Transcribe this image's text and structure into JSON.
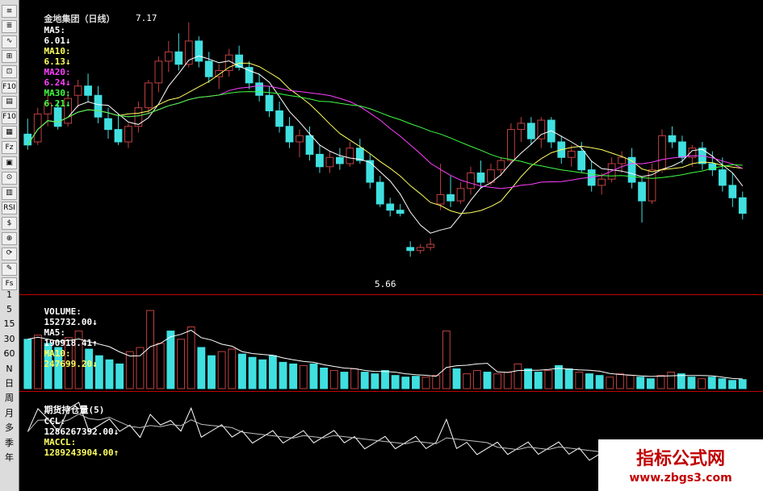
{
  "toolbar": {
    "buttons": [
      "≡",
      "≣",
      "∿",
      "⊞",
      "⊡",
      "F10",
      "▤",
      "F10",
      "▦",
      "Fz",
      "▣",
      "⊙",
      "▥",
      "RSI",
      "$",
      "⊕",
      "⟳",
      "✎",
      "Fs"
    ],
    "ylabels": [
      "1",
      "5",
      "15",
      "30",
      "60",
      "N",
      "日",
      "周",
      "月",
      "多",
      "季",
      "年"
    ]
  },
  "price_header": {
    "name": "金地集团（日线）",
    "ma5_label": "MA5:",
    "ma5_value": "6.01↓",
    "ma10_label": "MA10:",
    "ma10_value": "6.13↓",
    "ma20_label": "MA20:",
    "ma20_value": "6.24↓",
    "ma30_label": "MA30:",
    "ma30_value": "6.21↓"
  },
  "price_annotations": {
    "high": "7.17",
    "low": "5.66"
  },
  "volume_header": {
    "label": "VOLUME:",
    "value": "152732.00↓",
    "ma5_label": "MA5:",
    "ma5_value": "190918.41↑",
    "ma10_label": "MA10:",
    "ma10_value": "247699.20↓"
  },
  "oi_header": {
    "label": "期货持仓量(5)",
    "ccl_label": "CCL:",
    "ccl_value": "1286267392.00↓",
    "maccl_label": "MACCL:",
    "maccl_value": "1289243904.00↑"
  },
  "watermark": {
    "title": "指标公式网",
    "url": "www.zbgs3.com"
  },
  "colors": {
    "up": "#c04040",
    "down": "#40e0e0",
    "ma5": "#ffffff",
    "ma10": "#ffff60",
    "ma20": "#ff40ff",
    "ma30": "#40ff40",
    "grid": "#c00000",
    "oi": "#ffffff",
    "oi_ma": "#c0c0c0"
  },
  "chart_data": {
    "type": "candlestick",
    "price_range": [
      5.66,
      7.17
    ],
    "price_candles": [
      {
        "o": 6.45,
        "h": 6.55,
        "l": 6.35,
        "c": 6.38
      },
      {
        "o": 6.4,
        "h": 6.62,
        "l": 6.38,
        "c": 6.58
      },
      {
        "o": 6.58,
        "h": 6.7,
        "l": 6.5,
        "c": 6.65
      },
      {
        "o": 6.62,
        "h": 6.66,
        "l": 6.48,
        "c": 6.5
      },
      {
        "o": 6.52,
        "h": 6.72,
        "l": 6.5,
        "c": 6.68
      },
      {
        "o": 6.7,
        "h": 6.8,
        "l": 6.62,
        "c": 6.76
      },
      {
        "o": 6.76,
        "h": 6.84,
        "l": 6.66,
        "c": 6.7
      },
      {
        "o": 6.7,
        "h": 6.76,
        "l": 6.52,
        "c": 6.56
      },
      {
        "o": 6.55,
        "h": 6.62,
        "l": 6.42,
        "c": 6.48
      },
      {
        "o": 6.48,
        "h": 6.58,
        "l": 6.38,
        "c": 6.4
      },
      {
        "o": 6.4,
        "h": 6.52,
        "l": 6.36,
        "c": 6.5
      },
      {
        "o": 6.5,
        "h": 6.66,
        "l": 6.46,
        "c": 6.62
      },
      {
        "o": 6.62,
        "h": 6.8,
        "l": 6.58,
        "c": 6.78
      },
      {
        "o": 6.78,
        "h": 6.95,
        "l": 6.72,
        "c": 6.92
      },
      {
        "o": 6.92,
        "h": 7.05,
        "l": 6.85,
        "c": 6.98
      },
      {
        "o": 6.98,
        "h": 7.1,
        "l": 6.86,
        "c": 6.9
      },
      {
        "o": 6.9,
        "h": 7.17,
        "l": 6.88,
        "c": 7.05
      },
      {
        "o": 7.05,
        "h": 7.08,
        "l": 6.88,
        "c": 6.92
      },
      {
        "o": 6.92,
        "h": 6.98,
        "l": 6.78,
        "c": 6.82
      },
      {
        "o": 6.82,
        "h": 6.9,
        "l": 6.74,
        "c": 6.86
      },
      {
        "o": 6.86,
        "h": 7.0,
        "l": 6.82,
        "c": 6.96
      },
      {
        "o": 6.96,
        "h": 7.02,
        "l": 6.86,
        "c": 6.88
      },
      {
        "o": 6.88,
        "h": 6.92,
        "l": 6.74,
        "c": 6.78
      },
      {
        "o": 6.78,
        "h": 6.84,
        "l": 6.66,
        "c": 6.7
      },
      {
        "o": 6.7,
        "h": 6.76,
        "l": 6.56,
        "c": 6.6
      },
      {
        "o": 6.6,
        "h": 6.66,
        "l": 6.46,
        "c": 6.5
      },
      {
        "o": 6.5,
        "h": 6.56,
        "l": 6.36,
        "c": 6.4
      },
      {
        "o": 6.4,
        "h": 6.48,
        "l": 6.3,
        "c": 6.44
      },
      {
        "o": 6.44,
        "h": 6.5,
        "l": 6.28,
        "c": 6.32
      },
      {
        "o": 6.32,
        "h": 6.38,
        "l": 6.2,
        "c": 6.24
      },
      {
        "o": 6.24,
        "h": 6.34,
        "l": 6.2,
        "c": 6.3
      },
      {
        "o": 6.3,
        "h": 6.36,
        "l": 6.22,
        "c": 6.26
      },
      {
        "o": 6.26,
        "h": 6.4,
        "l": 6.24,
        "c": 6.36
      },
      {
        "o": 6.36,
        "h": 6.42,
        "l": 6.26,
        "c": 6.28
      },
      {
        "o": 6.28,
        "h": 6.32,
        "l": 6.1,
        "c": 6.14
      },
      {
        "o": 6.14,
        "h": 6.18,
        "l": 5.98,
        "c": 6.0
      },
      {
        "o": 6.0,
        "h": 6.04,
        "l": 5.92,
        "c": 5.96
      },
      {
        "o": 5.96,
        "h": 6.0,
        "l": 5.92,
        "c": 5.94
      },
      {
        "o": 5.72,
        "h": 5.76,
        "l": 5.66,
        "c": 5.7
      },
      {
        "o": 5.7,
        "h": 5.74,
        "l": 5.68,
        "c": 5.72
      },
      {
        "o": 5.72,
        "h": 5.78,
        "l": 5.7,
        "c": 5.74
      },
      {
        "o": 6.0,
        "h": 6.26,
        "l": 5.96,
        "c": 6.06
      },
      {
        "o": 6.06,
        "h": 6.18,
        "l": 5.98,
        "c": 6.02
      },
      {
        "o": 6.02,
        "h": 6.14,
        "l": 6.0,
        "c": 6.1
      },
      {
        "o": 6.1,
        "h": 6.24,
        "l": 6.06,
        "c": 6.2
      },
      {
        "o": 6.2,
        "h": 6.28,
        "l": 6.1,
        "c": 6.14
      },
      {
        "o": 6.14,
        "h": 6.26,
        "l": 6.12,
        "c": 6.22
      },
      {
        "o": 6.22,
        "h": 6.3,
        "l": 6.18,
        "c": 6.28
      },
      {
        "o": 6.28,
        "h": 6.52,
        "l": 6.26,
        "c": 6.48
      },
      {
        "o": 6.48,
        "h": 6.56,
        "l": 6.4,
        "c": 6.52
      },
      {
        "o": 6.52,
        "h": 6.56,
        "l": 6.38,
        "c": 6.42
      },
      {
        "o": 6.42,
        "h": 6.56,
        "l": 6.36,
        "c": 6.54
      },
      {
        "o": 6.54,
        "h": 6.56,
        "l": 6.36,
        "c": 6.4
      },
      {
        "o": 6.4,
        "h": 6.44,
        "l": 6.26,
        "c": 6.3
      },
      {
        "o": 6.3,
        "h": 6.38,
        "l": 6.24,
        "c": 6.34
      },
      {
        "o": 6.34,
        "h": 6.4,
        "l": 6.2,
        "c": 6.22
      },
      {
        "o": 6.22,
        "h": 6.28,
        "l": 6.08,
        "c": 6.12
      },
      {
        "o": 6.12,
        "h": 6.2,
        "l": 6.06,
        "c": 6.16
      },
      {
        "o": 6.16,
        "h": 6.3,
        "l": 6.14,
        "c": 6.26
      },
      {
        "o": 6.26,
        "h": 6.34,
        "l": 6.2,
        "c": 6.3
      },
      {
        "o": 6.3,
        "h": 6.36,
        "l": 6.1,
        "c": 6.14
      },
      {
        "o": 6.14,
        "h": 6.18,
        "l": 5.88,
        "c": 6.02
      },
      {
        "o": 6.02,
        "h": 6.26,
        "l": 6.0,
        "c": 6.22
      },
      {
        "o": 6.22,
        "h": 6.48,
        "l": 6.2,
        "c": 6.44
      },
      {
        "o": 6.44,
        "h": 6.5,
        "l": 6.36,
        "c": 6.4
      },
      {
        "o": 6.4,
        "h": 6.44,
        "l": 6.26,
        "c": 6.3
      },
      {
        "o": 6.3,
        "h": 6.38,
        "l": 6.24,
        "c": 6.36
      },
      {
        "o": 6.36,
        "h": 6.4,
        "l": 6.22,
        "c": 6.26
      },
      {
        "o": 6.26,
        "h": 6.34,
        "l": 6.18,
        "c": 6.22
      },
      {
        "o": 6.22,
        "h": 6.3,
        "l": 6.08,
        "c": 6.12
      },
      {
        "o": 6.12,
        "h": 6.2,
        "l": 5.98,
        "c": 6.04
      },
      {
        "o": 6.04,
        "h": 6.08,
        "l": 5.9,
        "c": 5.94
      }
    ],
    "volume": [
      {
        "v": 60,
        "up": false
      },
      {
        "v": 65,
        "up": true
      },
      {
        "v": 55,
        "up": false
      },
      {
        "v": 50,
        "up": false
      },
      {
        "v": 62,
        "up": true
      },
      {
        "v": 70,
        "up": true
      },
      {
        "v": 48,
        "up": false
      },
      {
        "v": 40,
        "up": false
      },
      {
        "v": 35,
        "up": false
      },
      {
        "v": 30,
        "up": false
      },
      {
        "v": 45,
        "up": true
      },
      {
        "v": 50,
        "up": true
      },
      {
        "v": 95,
        "up": true
      },
      {
        "v": 55,
        "up": true
      },
      {
        "v": 70,
        "up": false
      },
      {
        "v": 60,
        "up": true
      },
      {
        "v": 75,
        "up": true
      },
      {
        "v": 50,
        "up": false
      },
      {
        "v": 40,
        "up": false
      },
      {
        "v": 45,
        "up": true
      },
      {
        "v": 48,
        "up": true
      },
      {
        "v": 42,
        "up": false
      },
      {
        "v": 38,
        "up": false
      },
      {
        "v": 35,
        "up": false
      },
      {
        "v": 40,
        "up": false
      },
      {
        "v": 32,
        "up": false
      },
      {
        "v": 30,
        "up": false
      },
      {
        "v": 28,
        "up": true
      },
      {
        "v": 30,
        "up": false
      },
      {
        "v": 25,
        "up": false
      },
      {
        "v": 22,
        "up": true
      },
      {
        "v": 20,
        "up": false
      },
      {
        "v": 24,
        "up": true
      },
      {
        "v": 20,
        "up": false
      },
      {
        "v": 18,
        "up": false
      },
      {
        "v": 22,
        "up": false
      },
      {
        "v": 16,
        "up": false
      },
      {
        "v": 14,
        "up": false
      },
      {
        "v": 15,
        "up": false
      },
      {
        "v": 14,
        "up": true
      },
      {
        "v": 16,
        "up": true
      },
      {
        "v": 70,
        "up": true
      },
      {
        "v": 24,
        "up": false
      },
      {
        "v": 18,
        "up": true
      },
      {
        "v": 22,
        "up": true
      },
      {
        "v": 20,
        "up": false
      },
      {
        "v": 18,
        "up": true
      },
      {
        "v": 20,
        "up": true
      },
      {
        "v": 30,
        "up": true
      },
      {
        "v": 24,
        "up": false
      },
      {
        "v": 20,
        "up": false
      },
      {
        "v": 22,
        "up": true
      },
      {
        "v": 28,
        "up": false
      },
      {
        "v": 24,
        "up": false
      },
      {
        "v": 20,
        "up": true
      },
      {
        "v": 18,
        "up": false
      },
      {
        "v": 16,
        "up": false
      },
      {
        "v": 14,
        "up": true
      },
      {
        "v": 18,
        "up": true
      },
      {
        "v": 16,
        "up": true
      },
      {
        "v": 14,
        "up": false
      },
      {
        "v": 12,
        "up": false
      },
      {
        "v": 16,
        "up": true
      },
      {
        "v": 20,
        "up": true
      },
      {
        "v": 18,
        "up": false
      },
      {
        "v": 14,
        "up": false
      },
      {
        "v": 12,
        "up": true
      },
      {
        "v": 14,
        "up": false
      },
      {
        "v": 12,
        "up": false
      },
      {
        "v": 10,
        "up": false
      },
      {
        "v": 11,
        "up": false
      }
    ]
  }
}
